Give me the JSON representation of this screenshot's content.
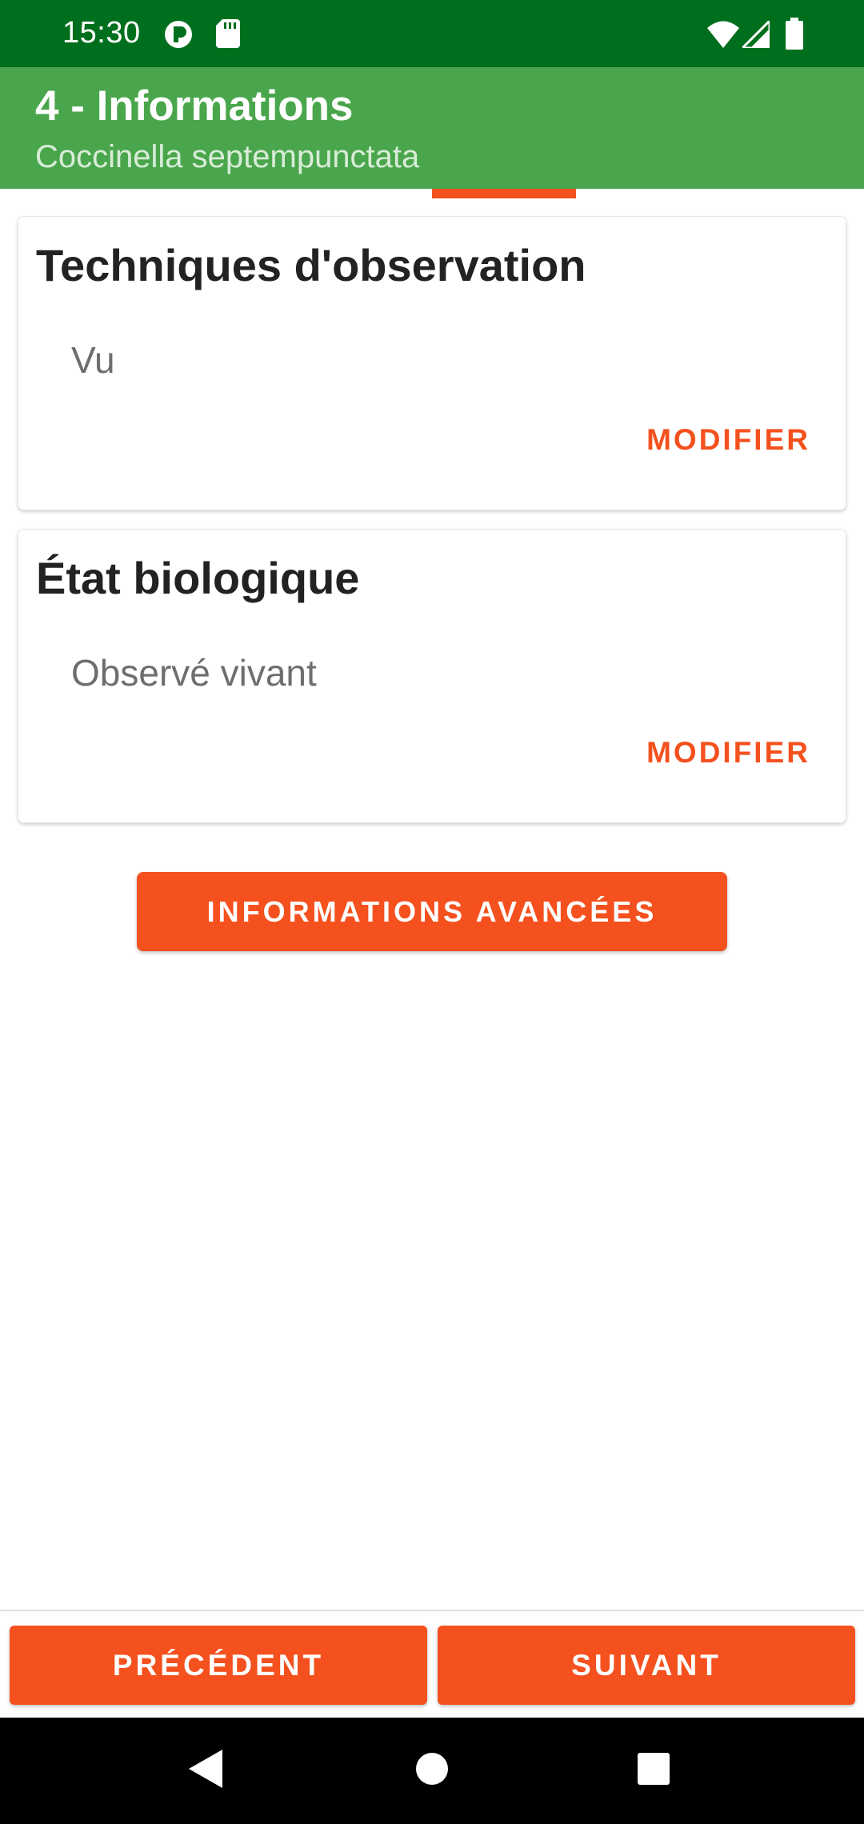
{
  "status_bar": {
    "time": "15:30",
    "left_icons": [
      "vpn-key-icon",
      "sd-card-icon"
    ],
    "right_icons": [
      "wifi-icon",
      "signal-icon",
      "battery-icon"
    ]
  },
  "app_bar": {
    "title": "4 - Informations",
    "subtitle": "Coccinella septempunctata",
    "background_color": "#4aa64c"
  },
  "cards": [
    {
      "title": "Techniques d'observation",
      "value": "Vu",
      "action_label": "MODIFIER"
    },
    {
      "title": "État biologique",
      "value": "Observé vivant",
      "action_label": "MODIFIER"
    }
  ],
  "advanced_button": {
    "label": "INFORMATIONS AVANCÉES"
  },
  "footer": {
    "previous_label": "PRÉCÉDENT",
    "next_label": "SUIVANT"
  },
  "system_nav": {
    "icons": [
      "back-icon",
      "home-icon",
      "recents-icon"
    ]
  },
  "colors": {
    "accent": "#f4511e",
    "status_bar": "#006f1d",
    "app_bar": "#4aa64c"
  }
}
